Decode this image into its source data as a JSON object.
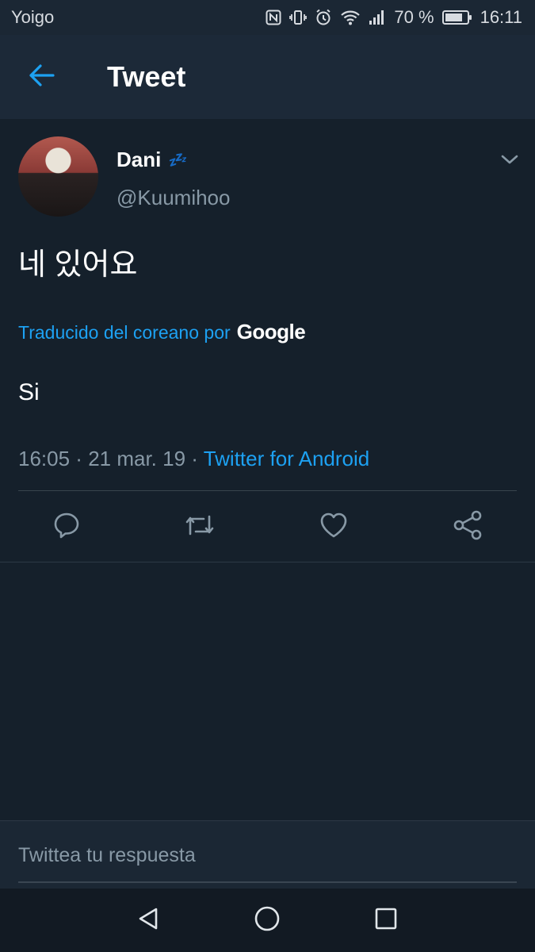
{
  "status_bar": {
    "carrier": "Yoigo",
    "battery_percent": "70 %",
    "time": "16:11",
    "icons": [
      "nfc-icon",
      "vibrate-icon",
      "alarm-icon",
      "wifi-icon",
      "signal-icon",
      "battery-icon"
    ]
  },
  "app_bar": {
    "back_icon": "arrow-left-icon",
    "title": "Tweet"
  },
  "tweet": {
    "author": {
      "display_name": "Dani",
      "emoji": "💤",
      "handle": "@Kuumihoo"
    },
    "menu_icon": "chevron-down-icon",
    "text": "네 있어요",
    "translation": {
      "label": "Traducido del coreano por",
      "provider": "Google",
      "text": "Si"
    },
    "time": "16:05",
    "date": "21 mar. 19",
    "separator": " · ",
    "source": "Twitter for Android",
    "actions": [
      "reply-icon",
      "retweet-icon",
      "like-icon",
      "share-icon"
    ]
  },
  "reply": {
    "placeholder": "Twittea tu respuesta"
  },
  "nav_bar": {
    "buttons": [
      "back-triangle-icon",
      "home-circle-icon",
      "recents-square-icon"
    ]
  },
  "colors": {
    "background": "#15202b",
    "app_bar": "#1c2938",
    "accent": "#1da1f2",
    "secondary_text": "#8899a6"
  }
}
